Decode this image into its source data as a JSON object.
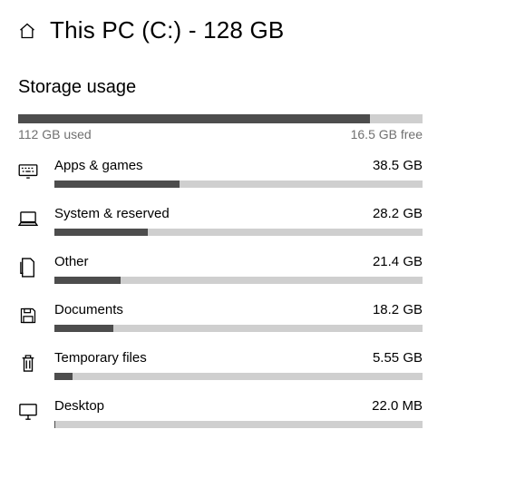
{
  "header": {
    "page_title": "This PC (C:) - 128 GB"
  },
  "section_heading": "Storage usage",
  "overview": {
    "total_gb": 128,
    "used_label": "112 GB used",
    "free_label": "16.5 GB free",
    "used_fraction": 0.871
  },
  "categories": [
    {
      "icon": "keyboard-icon",
      "label": "Apps & games",
      "size_label": "38.5 GB",
      "fraction": 0.34
    },
    {
      "icon": "laptop-icon",
      "label": "System & reserved",
      "size_label": "28.2 GB",
      "fraction": 0.253
    },
    {
      "icon": "file-icon",
      "label": "Other",
      "size_label": "21.4 GB",
      "fraction": 0.18
    },
    {
      "icon": "save-icon",
      "label": "Documents",
      "size_label": "18.2 GB",
      "fraction": 0.16
    },
    {
      "icon": "trash-icon",
      "label": "Temporary files",
      "size_label": "5.55 GB",
      "fraction": 0.05
    },
    {
      "icon": "monitor-icon",
      "label": "Desktop",
      "size_label": "22.0 MB",
      "fraction": 0.0015
    }
  ],
  "chart_data": {
    "type": "bar",
    "title": "Storage usage",
    "overview": {
      "used_gb": 112,
      "free_gb": 16.5,
      "total_gb": 128
    },
    "series": [
      {
        "name": "Apps & games",
        "value_gb": 38.5
      },
      {
        "name": "System & reserved",
        "value_gb": 28.2
      },
      {
        "name": "Other",
        "value_gb": 21.4
      },
      {
        "name": "Documents",
        "value_gb": 18.2
      },
      {
        "name": "Temporary files",
        "value_gb": 5.55
      },
      {
        "name": "Desktop",
        "value_gb": 0.022
      }
    ],
    "xlim_gb": [
      0,
      128
    ]
  }
}
